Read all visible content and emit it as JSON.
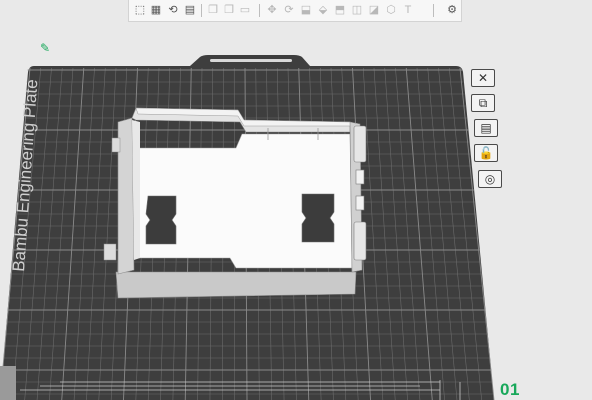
{
  "toolbar": {
    "buttons": [
      {
        "name": "add-part-icon",
        "glyph": "⬚",
        "dim": false
      },
      {
        "name": "grid-arrange-icon",
        "glyph": "▦",
        "dim": false
      },
      {
        "name": "auto-orient-icon",
        "glyph": "⟲",
        "dim": false
      },
      {
        "name": "layers-icon",
        "glyph": "▤",
        "dim": false
      },
      {
        "name": "copy-icon",
        "glyph": "❐",
        "dim": true
      },
      {
        "name": "paste-icon",
        "glyph": "❐",
        "dim": true
      },
      {
        "name": "delete-icon",
        "glyph": "▭",
        "dim": true
      },
      {
        "name": "move-icon",
        "glyph": "✥",
        "dim": true
      },
      {
        "name": "rotate-icon",
        "glyph": "⟳",
        "dim": true
      },
      {
        "name": "scale-icon",
        "glyph": "⬓",
        "dim": true
      },
      {
        "name": "lay-on-face-icon",
        "glyph": "⬙",
        "dim": true
      },
      {
        "name": "cut-icon",
        "glyph": "⬒",
        "dim": true
      },
      {
        "name": "support-paint-icon",
        "glyph": "◫",
        "dim": true
      },
      {
        "name": "seam-paint-icon",
        "glyph": "◪",
        "dim": true
      },
      {
        "name": "measure-icon",
        "glyph": "⬡",
        "dim": true
      },
      {
        "name": "text-icon",
        "glyph": "T",
        "dim": true
      },
      {
        "name": "assembly-icon",
        "glyph": "⚙",
        "dim": false
      }
    ]
  },
  "plate": {
    "label": "Bambu Engineering Plate",
    "number": "01"
  },
  "side_panel": [
    {
      "name": "close-plate-icon",
      "glyph": "✕"
    },
    {
      "name": "arrange-icon",
      "glyph": "⧉"
    },
    {
      "name": "plate-settings-icon",
      "glyph": "▤"
    },
    {
      "name": "lock-icon",
      "glyph": "🔓"
    },
    {
      "name": "orient-icon",
      "glyph": "◎"
    }
  ]
}
